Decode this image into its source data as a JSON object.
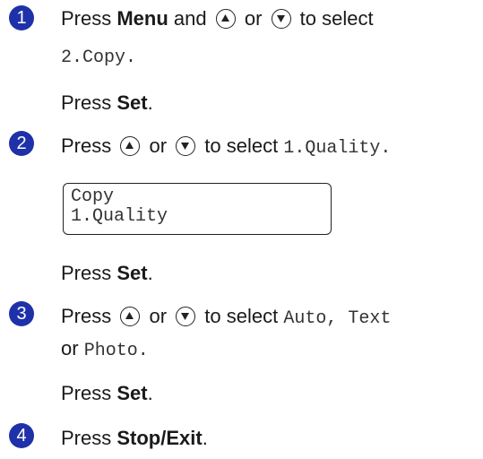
{
  "steps": [
    {
      "num": "1",
      "l1_a": "Press ",
      "l1_b": "Menu",
      "l1_c": " and ",
      "l1_d": " or ",
      "l1_e": " to select",
      "l2": "2.Copy.",
      "l3_a": "Press ",
      "l3_b": "Set",
      "l3_c": "."
    },
    {
      "num": "2",
      "l1_a": "Press ",
      "l1_b": " or ",
      "l1_c": " to select ",
      "l1_d": "1.Quality",
      "l1_e": ".",
      "lcd_line1": "Copy",
      "lcd_line2": "1.Quality",
      "l3_a": "Press ",
      "l3_b": "Set",
      "l3_c": "."
    },
    {
      "num": "3",
      "l1_a": "Press ",
      "l1_b": " or ",
      "l1_c": " to select ",
      "l1_d": "Auto",
      "l1_e": ", ",
      "l1_f": "Text",
      "l2_a": "or ",
      "l2_b": "Photo",
      "l2_c": ".",
      "l3_a": "Press ",
      "l3_b": "Set",
      "l3_c": "."
    },
    {
      "num": "4",
      "l1_a": "Press ",
      "l1_b": "Stop/Exit",
      "l1_c": "."
    }
  ],
  "icons": {
    "up": "up-arrow-button-icon",
    "down": "down-arrow-button-icon"
  },
  "colors": {
    "step_badge": "#1f31a8"
  }
}
